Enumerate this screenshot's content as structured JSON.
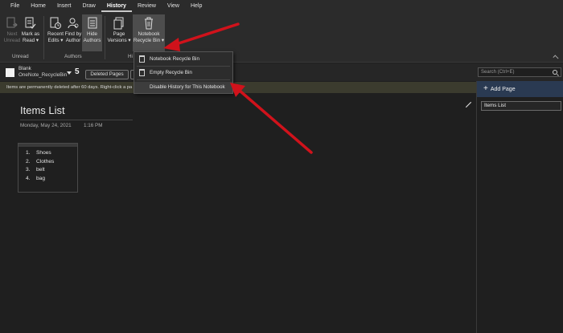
{
  "menu": {
    "tabs": [
      {
        "label": "File"
      },
      {
        "label": "Home"
      },
      {
        "label": "Insert"
      },
      {
        "label": "Draw"
      },
      {
        "label": "History"
      },
      {
        "label": "Review"
      },
      {
        "label": "View"
      },
      {
        "label": "Help"
      }
    ],
    "active": "History"
  },
  "ribbon": {
    "next_unread": {
      "l1": "Next",
      "l2": "Unread"
    },
    "mark_as_read": {
      "l1": "Mark as",
      "l2": "Read ▾"
    },
    "recent_edits": {
      "l1": "Recent",
      "l2": "Edits ▾"
    },
    "find_by_author": {
      "l1": "Find by",
      "l2": "Author"
    },
    "hide_authors": {
      "l1": "Hide",
      "l2": "Authors"
    },
    "page_versions": {
      "l1": "Page",
      "l2": "Versions ▾"
    },
    "recycle_bin": {
      "l1": "Notebook",
      "l2": "Recycle Bin ▾"
    },
    "groups": {
      "unread": "Unread",
      "authors": "Authors",
      "history": "Hi"
    }
  },
  "notebook_bar": {
    "name": "Blank",
    "section": "OneNote_RecycleBin",
    "count": "5",
    "tab": "Deleted Pages",
    "search_placeholder": "Search (Ctrl+E)"
  },
  "info_bar": {
    "text": "Items are permanently deleted after 60 days. Right-click a pa"
  },
  "page": {
    "title": "Items List",
    "date": "Monday, May 24, 2021",
    "time": "1:16 PM",
    "list": [
      {
        "num": "1.",
        "text": "Shoes"
      },
      {
        "num": "2.",
        "text": "Clothes"
      },
      {
        "num": "3.",
        "text": "belt"
      },
      {
        "num": "4.",
        "text": "bag"
      }
    ]
  },
  "right_panel": {
    "add_page": "Add Page",
    "pages": [
      "Items List"
    ]
  },
  "dropdown": {
    "items": [
      "Notebook Recycle Bin",
      "Empty Recycle Bin",
      "Disable History for This Notebook"
    ]
  },
  "colors": {
    "annotation_arrow": "#d0121b",
    "add_page_bg": "#2a3a52"
  }
}
